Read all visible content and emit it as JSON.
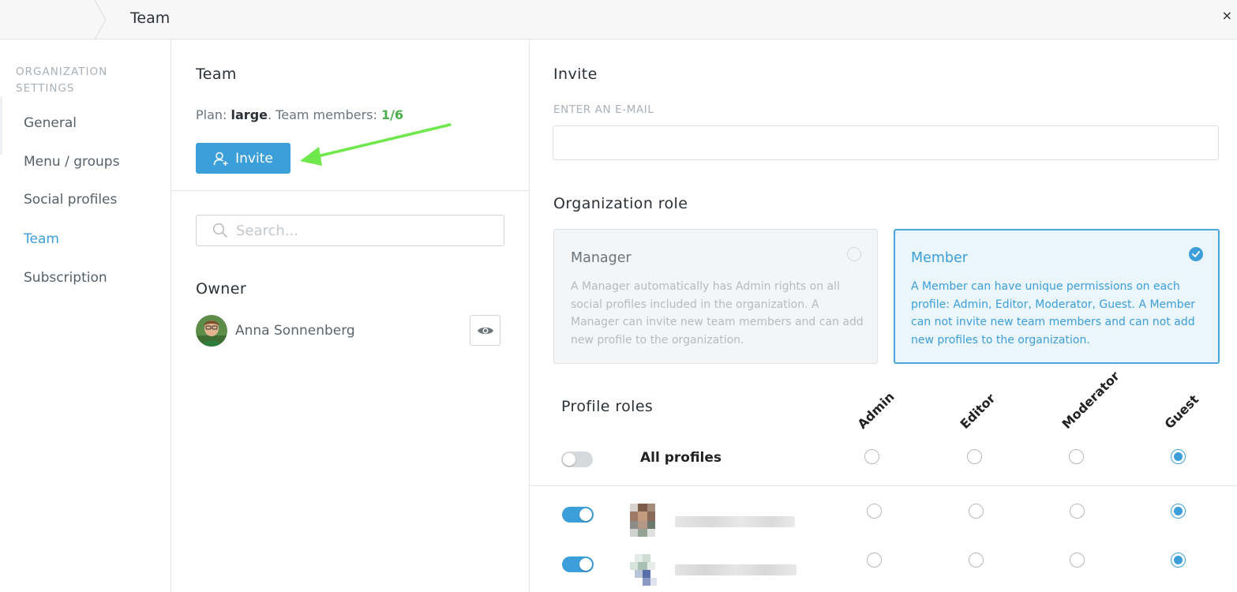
{
  "topbar": {
    "title": "Team",
    "close_label": "×"
  },
  "sidebar": {
    "heading": "ORGANIZATION SETTINGS",
    "items": [
      {
        "label": "General"
      },
      {
        "label": "Menu / groups"
      },
      {
        "label": "Social profiles"
      },
      {
        "label": "Team"
      },
      {
        "label": "Subscription"
      }
    ],
    "active_item": "Team"
  },
  "team": {
    "heading": "Team",
    "plan_prefix": "Plan: ",
    "plan_name": "large",
    "members_prefix": ". Team members: ",
    "members_count": "1/6",
    "invite_label": "Invite",
    "search_placeholder": "Search...",
    "owner_heading": "Owner",
    "owner_name": "Anna Sonnenberg"
  },
  "invite": {
    "heading": "Invite",
    "email_label": "ENTER AN E-MAIL",
    "email_value": "",
    "org_role_heading": "Organization role",
    "roles": [
      {
        "title": "Manager",
        "description": "A Manager automatically has Admin rights on all social profiles included in the organization. A Manager can invite new team members and can add new profile to the organization.",
        "selected": false
      },
      {
        "title": "Member",
        "description": "A Member can have unique permissions on each profile: Admin, Editor, Moderator, Guest. A Member can not invite new team members and can not add new profiles to the organization.",
        "selected": true
      }
    ],
    "profile_roles_heading": "Profile roles",
    "role_columns": [
      "Admin",
      "Editor",
      "Moderator",
      "Guest"
    ],
    "all_profiles_label": "All profiles",
    "all_profiles_toggle": "off",
    "all_profiles_selected_role": "Guest",
    "profiles": [
      {
        "toggle": "on",
        "selected_role": "Guest"
      },
      {
        "toggle": "on",
        "selected_role": "Guest"
      }
    ]
  },
  "colors": {
    "accent": "#3d9fd9",
    "count_green": "#4cae4c",
    "annotation_arrow": "#6ee84a"
  },
  "icons": [
    "chevron-breadcrumb-icon",
    "close-icon",
    "add-user-icon",
    "search-icon",
    "eye-icon",
    "checkmark-icon",
    "annotation-arrow-icon"
  ]
}
